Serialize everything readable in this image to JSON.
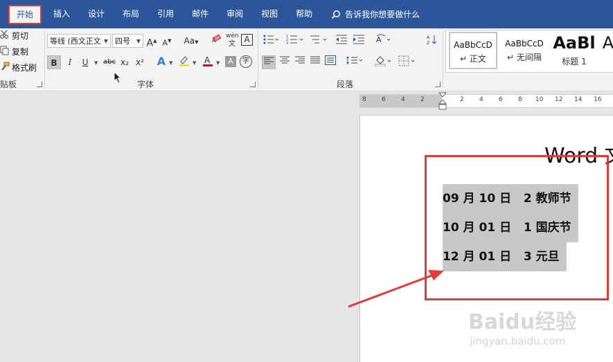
{
  "menu": {
    "tabs": [
      "开始",
      "插入",
      "设计",
      "布局",
      "引用",
      "邮件",
      "审阅",
      "视图",
      "帮助"
    ],
    "tell_me": "告诉我你想要做什么"
  },
  "clipboard": {
    "cut": "剪切",
    "copy": "复制",
    "format_painter": "格式刷",
    "group_label": "贴板"
  },
  "font": {
    "font_name": "等线 (西文正文",
    "font_size": "四号",
    "group_label": "字体",
    "buttons": {
      "bold": "B",
      "italic": "I",
      "underline": "U",
      "strike": "abc",
      "sub": "x₂",
      "sup": "x²",
      "change_case": "Aa",
      "phonetic": "wén",
      "border_char": "A",
      "enclose": "字"
    }
  },
  "paragraph": {
    "group_label": "段落"
  },
  "styles": {
    "items": [
      {
        "sample": "AaBbCcD",
        "name": "正文"
      },
      {
        "sample": "AaBbCcD",
        "name": "无间隔"
      },
      {
        "sample": "AaBl",
        "name": "标题 1"
      },
      {
        "sample": "A",
        "name": ""
      }
    ]
  },
  "ruler": {
    "numbers": [
      "8",
      "6",
      "4",
      "2",
      "2",
      "4",
      "6",
      "8",
      "10",
      "12",
      "14",
      "16"
    ]
  },
  "document": {
    "title": "Word 文",
    "lines": [
      "09 月 10 日   2 教师节",
      "10 月 01 日   1 国庆节",
      "12 月 01 日   3 元旦"
    ]
  },
  "watermark": {
    "logo": "Baidu经验",
    "url": "jingyan.baidu.com"
  },
  "colors": {
    "ribbon_blue": "#2b579a",
    "highlight": "#c8c8c8",
    "annotation_red": "#e53935"
  }
}
